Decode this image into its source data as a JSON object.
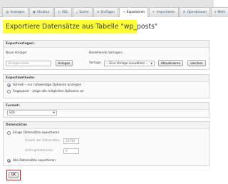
{
  "tabs": [
    {
      "icon": "▤",
      "label": "Anzeigen"
    },
    {
      "icon": "▣",
      "label": "Struktur"
    },
    {
      "icon": "◫",
      "label": "SQL"
    },
    {
      "icon": "⌕",
      "label": "Suche"
    },
    {
      "icon": "⊕",
      "label": "Einfügen"
    },
    {
      "icon": "⇥",
      "label": "Exportieren"
    },
    {
      "icon": "⇤",
      "label": "Importieren"
    },
    {
      "icon": "⚙",
      "label": "Operationen"
    },
    {
      "icon": "▾",
      "label": "Mehr"
    }
  ],
  "active_tab": "Exportieren",
  "page_title": "Exportiere Datensätze aus Tabelle \"wp_posts\"",
  "templates": {
    "heading": "Exportvorlagen:",
    "new_label": "Neue Vorlage:",
    "name_placeholder": "Vorlagenname",
    "create_button": "Anlegen",
    "existing_label": "Bestehende Vorlagen:",
    "template_label": "Vorlage:",
    "template_select": "-- Eine Vorlage auswählen --",
    "update_button": "Aktualisieren",
    "delete_button": "Löschen"
  },
  "method": {
    "heading": "Exportmethode:",
    "options": [
      {
        "label": "Schnell – nur notwendige Optionen anzeigen",
        "selected": true
      },
      {
        "label": "Angepasst – zeige alle möglichen Optionen an",
        "selected": false
      }
    ]
  },
  "format": {
    "heading": "Format:",
    "value": "SQL"
  },
  "rows": {
    "heading": "Datensätze:",
    "some_rows_label": "Einige Datensätze exportieren",
    "count_label": "Anzahl der Datensätze:",
    "count_value": "10730",
    "start_label": "Anfangsdatensatz:",
    "start_value": "0",
    "all_rows_label": "Alle Datensätze exportieren",
    "all_rows_selected": true
  },
  "ok_button": "OK",
  "colors": {
    "title_highlight": "#ffff33",
    "ok_highlight_border": "#d41c1c",
    "tab_text": "#235a81"
  }
}
